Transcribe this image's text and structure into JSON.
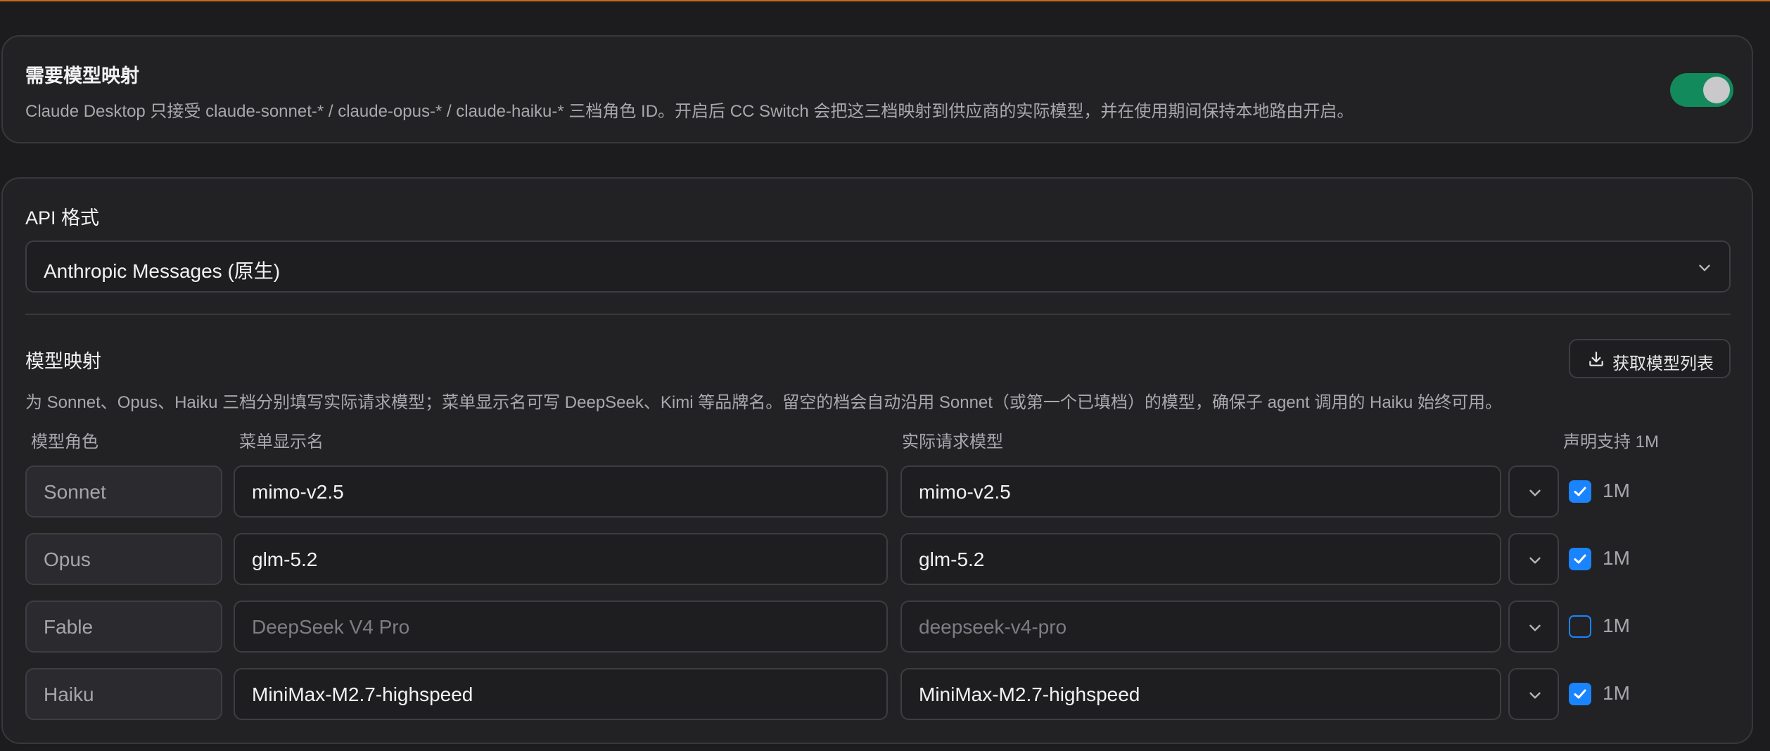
{
  "mapping_toggle": {
    "title": "需要模型映射",
    "description": "Claude Desktop 只接受 claude-sonnet-* / claude-opus-* / claude-haiku-* 三档角色 ID。开启后 CC Switch 会把这三档映射到供应商的实际模型，并在使用期间保持本地路由开启。",
    "enabled": true
  },
  "api_format": {
    "label": "API 格式",
    "selected": "Anthropic Messages (原生)"
  },
  "model_mapping": {
    "title": "模型映射",
    "fetch_button": "获取模型列表",
    "description": "为 Sonnet、Opus、Haiku 三档分别填写实际请求模型；菜单显示名可写 DeepSeek、Kimi 等品牌名。留空的档会自动沿用 Sonnet（或第一个已填档）的模型，确保子 agent 调用的 Haiku 始终可用。",
    "columns": {
      "role": "模型角色",
      "display_name": "菜单显示名",
      "actual_model": "实际请求模型",
      "supports_1m": "声明支持 1M"
    },
    "rows": [
      {
        "role": "Sonnet",
        "display_name": "mimo-v2.5",
        "display_placeholder": "",
        "actual_model": "mimo-v2.5",
        "actual_placeholder": "",
        "supports_1m": true,
        "checkbox_label": "1M"
      },
      {
        "role": "Opus",
        "display_name": "glm-5.2",
        "display_placeholder": "",
        "actual_model": "glm-5.2",
        "actual_placeholder": "",
        "supports_1m": true,
        "checkbox_label": "1M"
      },
      {
        "role": "Fable",
        "display_name": "",
        "display_placeholder": "DeepSeek V4 Pro",
        "actual_model": "",
        "actual_placeholder": "deepseek-v4-pro",
        "supports_1m": false,
        "checkbox_label": "1M"
      },
      {
        "role": "Haiku",
        "display_name": "MiniMax-M2.7-highspeed",
        "display_placeholder": "",
        "actual_model": "MiniMax-M2.7-highspeed",
        "actual_placeholder": "",
        "supports_1m": true,
        "checkbox_label": "1M"
      }
    ]
  },
  "colors": {
    "accent": "#1a84ff",
    "toggle_on": "#138a5b",
    "top_border": "#c96a1b"
  },
  "icons": {
    "dropdown": "chevron-down-icon",
    "fetch": "download-icon",
    "checkbox": "check-icon"
  }
}
